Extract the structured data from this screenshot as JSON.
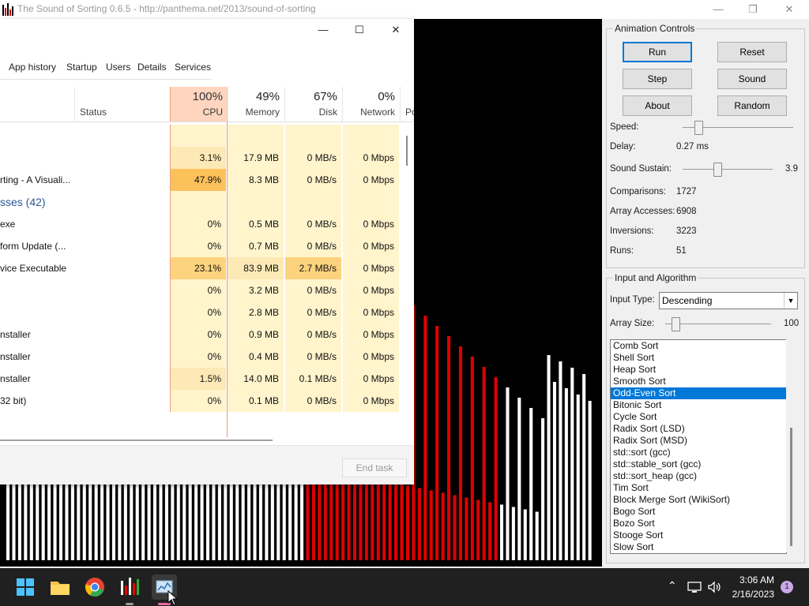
{
  "window": {
    "title": "The Sound of Sorting 0.6.5 - http://panthema.net/2013/sound-of-sorting",
    "minimize": "—",
    "maximize": "❐",
    "close": "✕"
  },
  "animation_controls": {
    "group_label": "Animation Controls",
    "buttons": {
      "run": "Run",
      "reset": "Reset",
      "step": "Step",
      "sound": "Sound",
      "about": "About",
      "random": "Random"
    },
    "speed_label": "Speed:",
    "delay_label": "Delay:",
    "delay_value": "0.27 ms",
    "sound_sustain_label": "Sound Sustain:",
    "sound_sustain_value": "3.9",
    "comparisons_label": "Comparisons:",
    "comparisons_value": "1727",
    "array_accesses_label": "Array Accesses:",
    "array_accesses_value": "6908",
    "inversions_label": "Inversions:",
    "inversions_value": "3223",
    "runs_label": "Runs:",
    "runs_value": "51"
  },
  "input_algorithm": {
    "group_label": "Input and Algorithm",
    "input_type_label": "Input Type:",
    "input_type_value": "Descending",
    "array_size_label": "Array Size:",
    "array_size_value": "100",
    "algorithms": [
      "Comb Sort",
      "Shell Sort",
      "Heap Sort",
      "Smooth Sort",
      "Odd-Even Sort",
      "Bitonic Sort",
      "Cycle Sort",
      "Radix Sort (LSD)",
      "Radix Sort (MSD)",
      "std::sort (gcc)",
      "std::stable_sort (gcc)",
      "std::sort_heap (gcc)",
      "Tim Sort",
      "Block Merge Sort (WikiSort)",
      "Bogo Sort",
      "Bozo Sort",
      "Stooge Sort",
      "Slow Sort"
    ],
    "selected_algorithm": "Odd-Even Sort"
  },
  "task_manager": {
    "minimize": "—",
    "maximize": "☐",
    "close": "✕",
    "tabs": [
      "App history",
      "Startup",
      "Users",
      "Details",
      "Services"
    ],
    "columns": {
      "status": "Status",
      "cpu_pct": "100%",
      "cpu": "CPU",
      "memory_pct": "49%",
      "memory": "Memory",
      "disk_pct": "67%",
      "disk": "Disk",
      "network_pct": "0%",
      "network": "Network",
      "power": "Po"
    },
    "rows": [
      {
        "name": "",
        "cpu": "",
        "memory": "",
        "disk": "",
        "network": ""
      },
      {
        "name": "",
        "cpu": "3.1%",
        "memory": "17.9 MB",
        "disk": "0 MB/s",
        "network": "0 Mbps"
      },
      {
        "name": "rting - A Visuali...",
        "cpu": "47.9%",
        "memory": "8.3 MB",
        "disk": "0 MB/s",
        "network": "0 Mbps"
      },
      {
        "name": "sses (42)",
        "cpu": "",
        "memory": "",
        "disk": "",
        "network": "",
        "group": true
      },
      {
        "name": "exe",
        "cpu": "0%",
        "memory": "0.5 MB",
        "disk": "0 MB/s",
        "network": "0 Mbps"
      },
      {
        "name": "form Update (...",
        "cpu": "0%",
        "memory": "0.7 MB",
        "disk": "0 MB/s",
        "network": "0 Mbps"
      },
      {
        "name": "vice Executable",
        "cpu": "23.1%",
        "memory": "83.9 MB",
        "disk": "2.7 MB/s",
        "network": "0 Mbps"
      },
      {
        "name": "",
        "cpu": "0%",
        "memory": "3.2 MB",
        "disk": "0 MB/s",
        "network": "0 Mbps"
      },
      {
        "name": "",
        "cpu": "0%",
        "memory": "2.8 MB",
        "disk": "0 MB/s",
        "network": "0 Mbps"
      },
      {
        "name": "nstaller",
        "cpu": "0%",
        "memory": "0.9 MB",
        "disk": "0 MB/s",
        "network": "0 Mbps"
      },
      {
        "name": "nstaller",
        "cpu": "0%",
        "memory": "0.4 MB",
        "disk": "0 MB/s",
        "network": "0 Mbps"
      },
      {
        "name": "nstaller",
        "cpu": "1.5%",
        "memory": "14.0 MB",
        "disk": "0.1 MB/s",
        "network": "0 Mbps"
      },
      {
        "name": "32 bit)",
        "cpu": "0%",
        "memory": "0.1 MB",
        "disk": "0 MB/s",
        "network": "0 Mbps"
      }
    ],
    "end_task": "End task"
  },
  "bars": {
    "count": 100,
    "values": [
      1,
      2,
      3,
      4,
      5,
      6,
      7,
      8,
      9,
      10,
      11,
      12,
      13,
      14,
      15,
      16,
      17,
      18,
      19,
      20,
      21,
      22,
      23,
      24,
      25,
      26,
      27,
      28,
      29,
      30,
      31,
      32,
      33,
      34,
      35,
      36,
      37,
      38,
      39,
      40,
      41,
      42,
      43,
      44,
      45,
      46,
      47,
      48,
      49,
      50,
      51,
      52,
      53,
      54,
      55,
      56,
      57,
      58,
      59,
      60,
      61,
      62,
      63,
      64,
      65,
      66,
      67,
      68,
      69,
      70,
      71,
      72,
      73,
      74,
      75,
      76,
      77,
      78,
      79,
      80,
      81,
      82,
      83,
      84,
      85,
      86,
      87,
      88,
      89,
      90,
      91,
      92,
      93,
      94,
      95,
      96,
      97,
      98,
      99,
      100
    ],
    "colors": {
      "sorted": "#ffffff",
      "active": "#e00000"
    }
  },
  "taskbar": {
    "time": "3:06 AM",
    "date": "2/16/2023",
    "notifications": "1"
  }
}
